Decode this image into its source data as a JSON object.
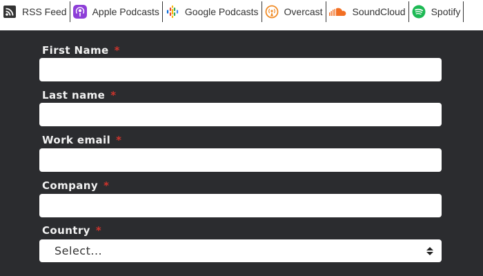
{
  "podcast_links": [
    {
      "label": "RSS Feed",
      "icon": "rss-icon"
    },
    {
      "label": "Apple Podcasts",
      "icon": "apple-podcasts-icon"
    },
    {
      "label": "Google Podcasts",
      "icon": "google-podcasts-icon"
    },
    {
      "label": "Overcast",
      "icon": "overcast-icon"
    },
    {
      "label": "SoundCloud",
      "icon": "soundcloud-icon"
    },
    {
      "label": "Spotify",
      "icon": "spotify-icon"
    }
  ],
  "form": {
    "first_name": {
      "label": "First Name",
      "required": "*",
      "value": ""
    },
    "last_name": {
      "label": "Last name",
      "required": "*",
      "value": ""
    },
    "work_email": {
      "label": "Work email",
      "required": "*",
      "value": ""
    },
    "company": {
      "label": "Company",
      "required": "*",
      "value": ""
    },
    "country": {
      "label": "Country",
      "required": "*",
      "selected": "Select..."
    }
  },
  "colors": {
    "background": "#2b2c2f",
    "required_marker": "#d0342c",
    "apple_podcasts": "#8e3fd8",
    "overcast": "#f08a24",
    "soundcloud": "#f26f23",
    "spotify": "#1db954"
  }
}
